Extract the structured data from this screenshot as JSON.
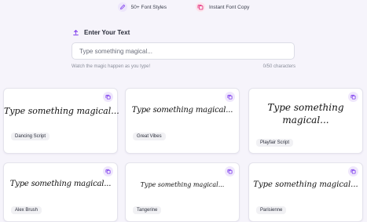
{
  "features": {
    "font_styles": "50+ Font Styles",
    "instant_copy": "Instant Font Copy"
  },
  "input": {
    "title": "Enter Your Text",
    "placeholder": "Type something magical...",
    "value": "",
    "hint": "Watch the magic happen as you type!",
    "counter": "0/50 characters"
  },
  "cards": [
    {
      "font_name": "Dancing Script",
      "preview": "Type something magical..."
    },
    {
      "font_name": "Great Vibes",
      "preview": "Type something magical..."
    },
    {
      "font_name": "Playfair Script",
      "preview_line1": "Type something",
      "preview_line2": "magical..."
    },
    {
      "font_name": "Alex Brush",
      "preview": "Type something magical..."
    },
    {
      "font_name": "Tangerine",
      "preview": "Type something magical..."
    },
    {
      "font_name": "Parisienne",
      "preview": "Type something magical..."
    }
  ],
  "colors": {
    "background": "#f6f4fb",
    "accent": "#7c3aed",
    "copy_accent": "#e11d74",
    "card_border": "#e4e3ec"
  },
  "icons": {
    "feature_1": "pen-icon",
    "feature_2": "copy-icon",
    "title": "upload-arrow-icon",
    "card_action": "copy-icon"
  }
}
